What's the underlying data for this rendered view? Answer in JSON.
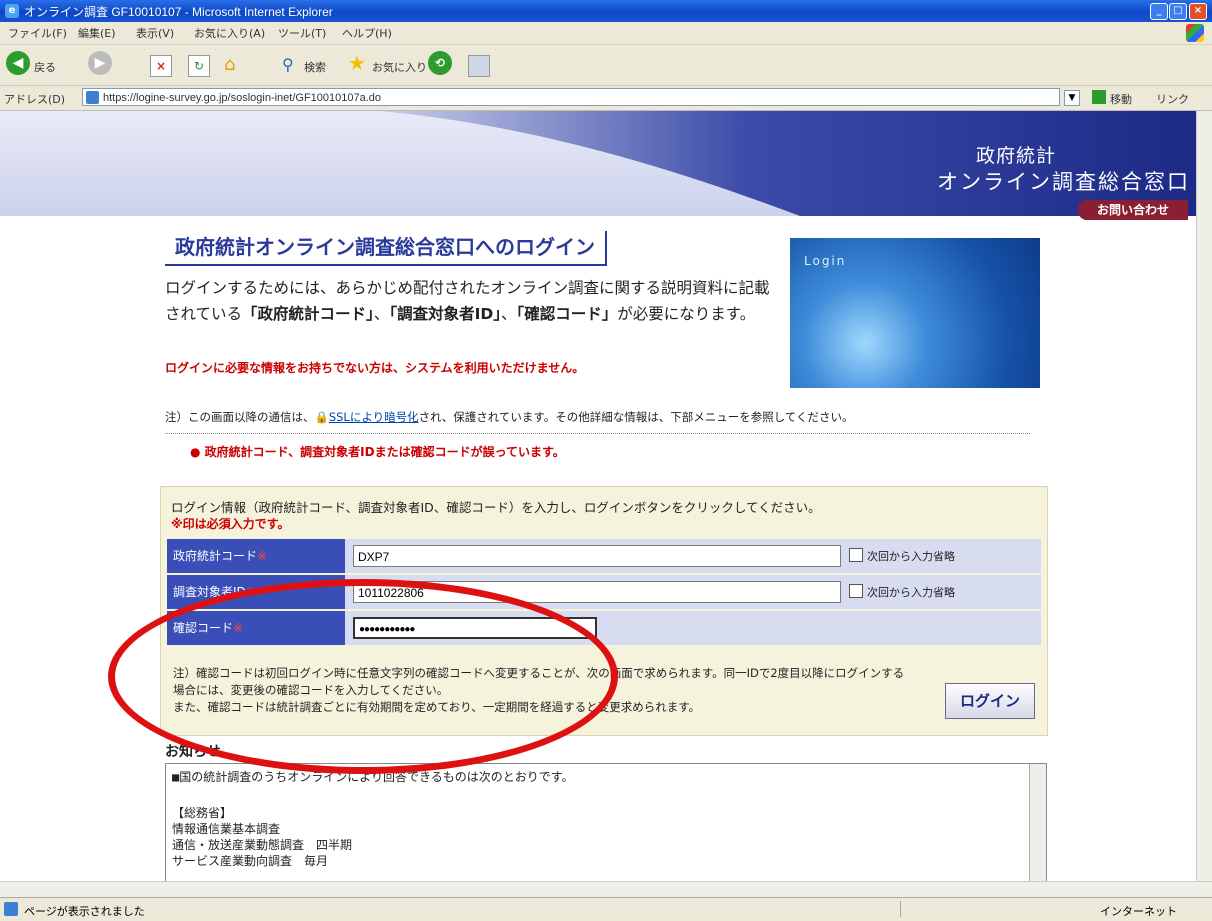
{
  "window": {
    "title": "オンライン調査 GF10010107 - Microsoft Internet Explorer",
    "min_label": "_",
    "max_label": "□",
    "close_label": "×"
  },
  "menu": [
    "ファイル(F)",
    "編集(E)",
    "表示(V)",
    "お気に入り(A)",
    "ツール(T)",
    "ヘルプ(H)"
  ],
  "toolbar": {
    "back_label": "戻る",
    "search_label": "検索",
    "favorites_label": "お気に入り"
  },
  "address": {
    "label": "アドレス(D)",
    "url": "https://logine-survey.go.jp/soslogin-inet/GF10010107a.do",
    "go_label": "移動",
    "links_label": "リンク"
  },
  "banner": {
    "line1": "政府統計",
    "line2": "オンライン調査総合窓口",
    "inquiry": "お問い合わせ"
  },
  "page": {
    "heading": "政府統計オンライン調査総合窓口へのログイン",
    "intro_a": "ログインするためには、あらかじめ配付されたオンライン調査に関する説明資料に記載されている",
    "intro_b": "「政府統計コード」",
    "intro_c": "、",
    "intro_d": "「調査対象者ID」",
    "intro_e": "、",
    "intro_f": "「確認コード」",
    "intro_g": "が必要になります。",
    "warn": "ログインに必要な情報をお持ちでない方は、システムを利用いただけません。",
    "image_text": "Login",
    "ssl_pre": "注）この画面以降の通信は、",
    "ssl_link": "SSLにより暗号化",
    "ssl_post": "され、保護されています。その他詳細な情報は、下部メニューを参照してください。",
    "error": "● 政府統計コード、調査対象者IDまたは確認コードが誤っています。"
  },
  "form": {
    "instruction": "ログイン情報（政府統計コード、調査対象者ID、確認コード）を入力し、ログインボタンをクリックしてください。",
    "required_note": "※印は必須入力です。",
    "fields": [
      {
        "label": "政府統計コード",
        "value": "DXP7",
        "checkbox": "次回から入力省略"
      },
      {
        "label": "調査対象者ID",
        "value": "1011022806",
        "checkbox": "次回から入力省略"
      },
      {
        "label": "確認コード",
        "value": "●●●●●●●●●●●"
      }
    ],
    "star": "※",
    "note1": "注）確認コードは初回ログイン時に任意文字列の確認コードへ変更することが、次の画面で求められます。同一IDで2度目以降にログインする場合には、変更後の確認コードを入力してください。",
    "note2": "また、確認コードは統計調査ごとに有効期間を定めており、一定期間を経過すると変更求められます。",
    "login_button": "ログイン"
  },
  "news": {
    "heading": "お知らせ",
    "lines": [
      "■国の統計調査のうちオンラインにより回答できるものは次のとおりです。",
      "",
      "【総務省】",
      " 情報通信業基本調査",
      " 通信・放送産業動態調査　四半期",
      " サービス産業動向調査　毎月"
    ]
  },
  "status": {
    "text": "ページが表示されました",
    "zone": "インターネット"
  },
  "colors": {
    "annotation_oval": "#dd1111",
    "form_label_bg": "#3a4eb8",
    "heading": "#2a3a9a"
  }
}
